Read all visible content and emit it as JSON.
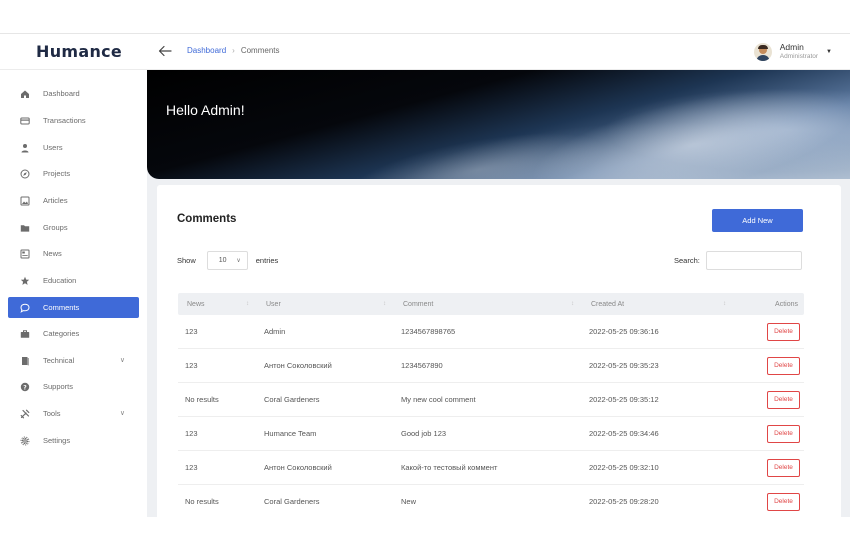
{
  "app": {
    "logo": "Humance"
  },
  "header": {
    "breadcrumb": {
      "parent": "Dashboard",
      "current": "Comments"
    },
    "user": {
      "name": "Admin",
      "role": "Administrator"
    }
  },
  "sidebar": {
    "items": [
      {
        "label": "Dashboard",
        "icon": "home-icon"
      },
      {
        "label": "Transactions",
        "icon": "card-icon"
      },
      {
        "label": "Users",
        "icon": "user-icon"
      },
      {
        "label": "Projects",
        "icon": "compass-icon"
      },
      {
        "label": "Articles",
        "icon": "image-icon"
      },
      {
        "label": "Groups",
        "icon": "folder-icon"
      },
      {
        "label": "News",
        "icon": "newspaper-icon"
      },
      {
        "label": "Education",
        "icon": "star-icon"
      },
      {
        "label": "Comments",
        "icon": "comment-icon",
        "active": true
      },
      {
        "label": "Categories",
        "icon": "briefcase-icon"
      },
      {
        "label": "Technical",
        "icon": "book-icon",
        "expandable": true
      },
      {
        "label": "Supports",
        "icon": "question-icon"
      },
      {
        "label": "Tools",
        "icon": "tools-icon",
        "expandable": true
      },
      {
        "label": "Settings",
        "icon": "gear-icon"
      }
    ]
  },
  "hero": {
    "greeting": "Hello Admin!"
  },
  "comments": {
    "title": "Comments",
    "add_label": "Add New",
    "show_label": "Show",
    "entries_value": "10",
    "entries_label": "entries",
    "search_label": "Search:",
    "search_value": "",
    "columns": [
      "News",
      "User",
      "Comment",
      "Created At",
      "Actions"
    ],
    "rows": [
      {
        "news": "123",
        "user": "Admin",
        "comment": "1234567898765",
        "created": "2022-05-25 09:36:16",
        "action": "Delete"
      },
      {
        "news": "123",
        "user": "Антон Соколовский",
        "comment": "1234567890",
        "created": "2022-05-25 09:35:23",
        "action": "Delete"
      },
      {
        "news": "No results",
        "user": "Coral Gardeners",
        "comment": "My new cool comment",
        "created": "2022-05-25 09:35:12",
        "action": "Delete"
      },
      {
        "news": "123",
        "user": "Humance Team",
        "comment": "Good job 123",
        "created": "2022-05-25 09:34:46",
        "action": "Delete"
      },
      {
        "news": "123",
        "user": "Антон Соколовский",
        "comment": "Какой-то тестовый коммент",
        "created": "2022-05-25 09:32:10",
        "action": "Delete"
      },
      {
        "news": "No results",
        "user": "Coral Gardeners",
        "comment": "New",
        "created": "2022-05-25 09:28:20",
        "action": "Delete"
      }
    ]
  },
  "colors": {
    "accent": "#3f6ad8",
    "danger": "#e04646",
    "background": "#eef0f3"
  }
}
